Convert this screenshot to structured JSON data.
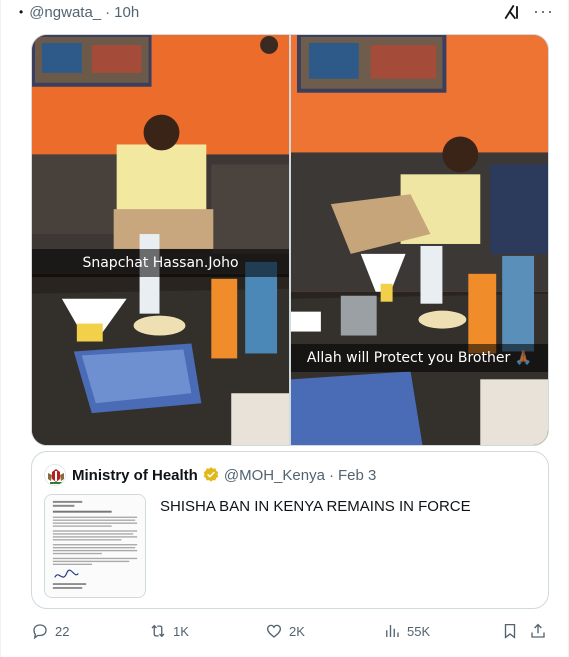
{
  "header": {
    "handle": "@ngwata_",
    "separator": "·",
    "time": "10h",
    "more_label": "···",
    "grok_icon": "grok-icon"
  },
  "media": {
    "left_caption": "Snapchat Hassan.Joho",
    "right_caption": "Allah  will Protect you Brother 🙏🏾"
  },
  "quote": {
    "name": "Ministry of Health",
    "handle": "@MOH_Kenya",
    "separator": "·",
    "date": "Feb 3",
    "text": "SHISHA BAN IN KENYA REMAINS IN FORCE",
    "verified_color": "#e2b719"
  },
  "actions": {
    "replies": "22",
    "retweets": "1K",
    "likes": "2K",
    "views": "55K"
  }
}
